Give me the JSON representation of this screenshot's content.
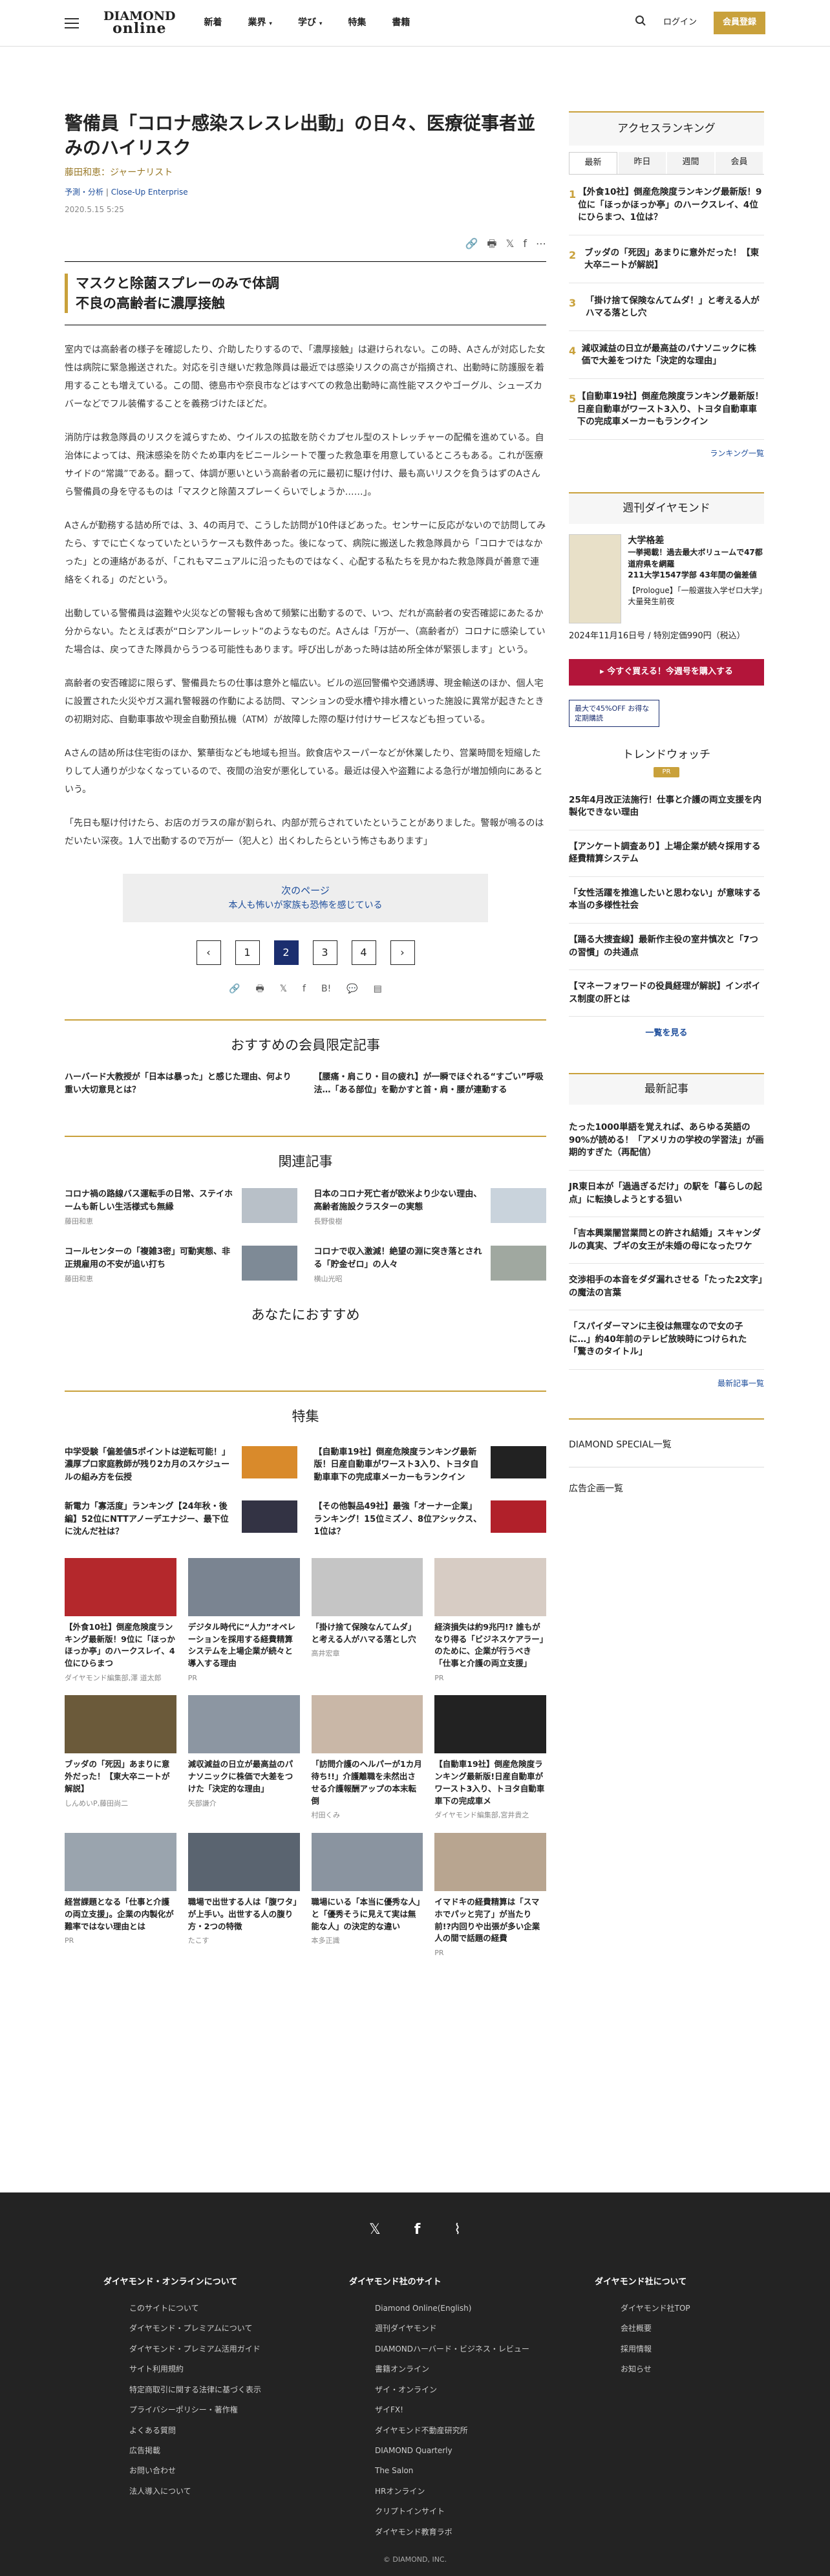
{
  "header": {
    "logo_top": "DIAMOND",
    "logo_bottom": "online",
    "nav": [
      "新着",
      "業界",
      "学び",
      "特集",
      "書籍"
    ],
    "login": "ログイン",
    "register": "会員登録"
  },
  "article": {
    "title": "警備員「コロナ感染スレスレ出動」の日々、医療従事者並みのハイリスク",
    "author": "藤田和恵：ジャーナリスト",
    "category": "予測・分析",
    "series": "Close-Up Enterprise",
    "date": "2020.5.15 5:25",
    "lead": "マスクと除菌スプレーのみで体調不良の高齢者に濃厚接触",
    "paragraphs": [
      "室内では高齢者の様子を確認したり、介助したりするので、「濃厚接触」は避けられない。この時、Aさんが対応した女性は病院に緊急搬送された。対応を引き継いだ救急隊員は最近では感染リスクの高さが指摘され、出動時に防護服を着用することも増えている。この間、徳島市や奈良市などはすべての救急出動時に高性能マスクやゴーグル、シューズカバーなどでフル装備することを義務づけたほどだ。",
      "消防庁は救急隊員のリスクを減らすため、ウイルスの拡散を防ぐカプセル型のストレッチャーの配備を進めている。自治体によっては、飛沫感染を防ぐため車内をビニールシートで覆った救急車を用意しているところもある。これが医療サイドの“常識”である。翻って、体調が悪いという高齢者の元に最初に駆け付け、最も高いリスクを負うはずのAさんら警備員の身を守るものは「マスクと除菌スプレーくらいでしょうか……」。",
      "Aさんが勤務する詰め所では、3、4の両月で、こうした訪問が10件ほどあった。センサーに反応がないので訪問してみたら、すでに亡くなっていたというケースも数件あった。後になって、病院に搬送した救急隊員から「コロナではなかった」との連絡があるが、「これもマニュアルに沿ったものではなく、心配する私たちを見かねた救急隊員が善意で連絡をくれる」のだという。",
      "出動している警備員は盗難や火災などの警報も含めて頻繁に出動するので、いつ、だれが高齢者の安否確認にあたるか分からない。たとえば表が“ロシアンルーレット”のようなものだ。Aさんは「万が一、（高齢者が）コロナに感染していた場合は、戻ってきた隊員からうつる可能性もあります。呼び出しがあった時は詰め所全体が緊張します」という。",
      "高齢者の安否確認に限らず、警備員たちの仕事は意外と幅広い。ビルの巡回警備や交通誘導、現金輸送のほか、個人宅に設置された火災やガス漏れ警報器の作動による訪問、マンションの受水槽や排水槽といった施設に異常が起きたときの初期対応、自動車事故や現金自動預払機（ATM）が故障した際の駆け付けサービスなども担っている。",
      "Aさんの詰め所は住宅街のほか、繁華街なども地域も担当。飲食店やスーパーなどが休業したり、営業時間を短縮したりして人通りが少なくなっているので、夜間の治安が悪化している。最近は侵入や盗難による急行が増加傾向にあるという。",
      "「先日も駆け付けたら、お店のガラスの扉が割られ、内部が荒らされていたということがありました。警報が鳴るのはだいたい深夜。1人で出動するので万が一（犯人と）出くわしたらという怖さもあります」"
    ],
    "next_label": "次のページ",
    "next_title": "本人も怖いが家族も恐怖を感じている",
    "pages": [
      "1",
      "2",
      "3",
      "4"
    ],
    "current_page": "2"
  },
  "member": {
    "heading": "おすすめの会員限定記事",
    "items": [
      "ハーバード大教授が「日本は暴った」と感じた理由、何より重い大切意見とは？",
      "【腰痛・肩こり・目の疲れ】が一瞬でほぐれる“すごい”呼吸法…「ある部位」を動かすと首・肩・腰が連動する"
    ]
  },
  "related": {
    "heading": "関連記事",
    "items": [
      {
        "title": "コロナ禍の路線バス運転手の日常、ステイホームも新しい生活様式も無縁",
        "author": "藤田和恵"
      },
      {
        "title": "日本のコロナ死亡者が欧米より少ない理由、高齢者施設クラスターの実態",
        "author": "長野俊樹"
      },
      {
        "title": "コールセンターの「複雑3密」可動実態、非正規雇用の不安が追い打ち",
        "author": "藤田和恵"
      },
      {
        "title": "コロナで収入激減！絶望の淵に突き落とされる「貯金ゼロ」の人々",
        "author": "横山光昭"
      }
    ]
  },
  "recommend": {
    "heading": "あなたにおすすめ"
  },
  "features": {
    "heading": "特集",
    "items": [
      "中学受験「偏差値5ポイントは逆転可能！」濃厚プロ家庭教師が残り2カ月のスケジュールの組み方を伝授",
      "【自動車19社】倒産危険度ランキング最新版！日産自動車がワースト3入り、トヨタ自動車車下の完成車メーカーもランクイン",
      "新電力「寡活度」ランキング【24年秋・後編】52位にNTTアノーデエナジー、最下位に沈んだ社は？",
      "【その他製品49社】最強「オーナー企業」ランキング！15位ミズノ、8位アシックス、1位は？"
    ]
  },
  "cards": [
    {
      "title": "【外食10社】倒産危険度ランキング最新版！9位に「ほっかほっか亭」のハークスレイ、4位にひらまつ",
      "author": "ダイヤモンド編集部,澤 道太郎"
    },
    {
      "title": "デジタル時代に“人力”オペレーションを採用する経費精算システムを上場企業が続々と導入する理由",
      "author": "PR"
    },
    {
      "title": "「掛け捨て保険なんてムダ」と考える人がハマる落とし穴",
      "author": "高井宏章"
    },
    {
      "title": "経済損失は約9兆円!? 誰もがなり得る「ビジネスケアラー」のために、企業が行うべき「仕事と介護の両立支援」",
      "author": "PR"
    },
    {
      "title": "ブッダの「死因」あまりに意外だった！【東大卒ニートが解説】",
      "author": "しんめいP,藤田尚二"
    },
    {
      "title": "減収減益の日立が最高益のパナソニックに株価で大差をつけた「決定的な理由」",
      "author": "矢部謙介"
    },
    {
      "title": "「訪問介護のヘルパーが1カ月待ち!!」介護離職を未然出させる介護報酬アップの本末転倒",
      "author": "村田くみ"
    },
    {
      "title": "【自動車19社】倒産危険度ランキング最新版!日産自動車がワースト3入り、トヨタ自動車車下の完成車メ",
      "author": "ダイヤモンド編集部,宮井貴之"
    },
    {
      "title": "経営課題となる「仕事と介護の両立支援」。企業の内製化が難率ではない理由とは",
      "author": "PR"
    },
    {
      "title": "職場で出世する人は「腹ワタ」が上手い。出世する人の腹り方・2つの特徴",
      "author": "たこす"
    },
    {
      "title": "職場にいる「本当に優秀な人」と「優秀そうに見えて実は無能な人」の決定的な違い",
      "author": "本多正識"
    },
    {
      "title": "イマドキの経費精算は「スマホでパッと完了」が当たり前!?内回りや出張が多い企業人の間で話題の経費",
      "author": "PR"
    }
  ],
  "sidebar": {
    "ranking_heading": "アクセスランキング",
    "tabs": [
      "最新",
      "昨日",
      "週間",
      "会員"
    ],
    "ranking": [
      {
        "n": "1",
        "t": "【外食10社】倒産危険度ランキング最新版！9位に「ほっかほっか亭」のハークスレイ、4位にひらまつ、1位は？"
      },
      {
        "n": "2",
        "t": "ブッダの「死因」あまりに意外だった！【東大卒ニートが解説】"
      },
      {
        "n": "3",
        "t": "「掛け捨て保険なんてムダ！」と考える人がハマる落とし穴"
      },
      {
        "n": "4",
        "t": "減収減益の日立が最高益のパナソニックに株価で大差をつけた「決定的な理由」"
      },
      {
        "n": "5",
        "t": "【自動車19社】倒産危険度ランキング最新版！日産自動車がワースト3入り、トヨタ自動車車下の完成車メーカーもランクイン"
      }
    ],
    "ranking_more": "ランキング一覧",
    "weekly_heading": "週刊ダイヤモンド",
    "mag_lines": [
      "大学格差",
      "一挙掲載！過去最大ボリュームで47都道府県を網羅",
      "211大学1547学部 43年間の偏差値",
      "【Prologue】「一般選抜入学ゼロ大学」大量発生前夜"
    ],
    "mag_date": "2024年11月16日号 / 特別定価990円（税込）",
    "buy": "▸ 今すぐ買える！今週号を購入する",
    "discount": "最大で45%OFF お得な定期購読",
    "trend_heading": "トレンドウォッチ",
    "trend_badge": "PR",
    "trends": [
      "25年4月改正法施行！仕事と介護の両立支援を内製化できない理由",
      "【アンケート調査あり】上場企業が続々採用する経費精算システム",
      "「女性活躍を推進したいと思わない」が意味する本当の多様性社会",
      "【踊る大捜査線】最新作主役の室井慎次と「7つの習慣」の共通点",
      "【マネーフォワードの役員経理が解説】インボイス制度の肝とは"
    ],
    "trend_more": "一覧を見る",
    "latest_heading": "最新記事",
    "latest": [
      "たった1000単語を覚えれば、あらゆる英語の90%が読める！「アメリカの学校の学習法」が画期的すぎた（再配信）",
      "JR東日本が「過過ぎるだけ」の駅を「暮らしの起点」に転換しようとする狙い",
      "「吉本興業闇営業問との許され結婚」スキャンダルの真実、ブギの女王が未婚の母になったワケ",
      "交渉相手の本音をダダ漏れさせる「たった2文字」の魔法の言葉",
      "「スパイダーマンに主役は無理なので女の子に…」約40年前のテレビ放映時につけられた「驚きのタイトル」"
    ],
    "latest_more": "最新記事一覧",
    "special": "DIAMOND SPECIAL一覧",
    "ad": "広告企画一覧"
  },
  "footer": {
    "col1_title": "ダイヤモンド・オンラインについて",
    "col1": [
      "このサイトについて",
      "ダイヤモンド・プレミアムについて",
      "ダイヤモンド・プレミアム活用ガイド",
      "サイト利用規約",
      "特定商取引に関する法律に基づく表示",
      "プライバシーポリシー・著作権",
      "よくある質問",
      "広告掲載",
      "お問い合わせ",
      "法人導入について"
    ],
    "col2_title": "ダイヤモンド社のサイト",
    "col2": [
      "Diamond Online(English)",
      "週刊ダイヤモンド",
      "DIAMONDハーバード・ビジネス・レビュー",
      "書籍オンライン",
      "ザイ・オンライン",
      "ザイFX!",
      "ダイヤモンド不動産研究所",
      "DIAMOND Quarterly",
      "The Salon",
      "HRオンライン",
      "クリプトインサイト",
      "ダイヤモンド教育ラボ"
    ],
    "col3_title": "ダイヤモンド社について",
    "col3": [
      "ダイヤモンド社TOP",
      "会社概要",
      "採用情報",
      "お知らせ"
    ],
    "copyright": "© DIAMOND, INC."
  }
}
